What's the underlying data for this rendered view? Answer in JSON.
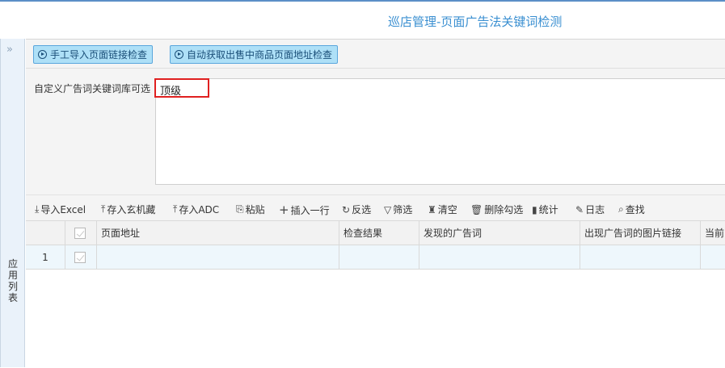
{
  "page": {
    "title": "巡店管理-页面广告法关键词检测"
  },
  "sidebar": {
    "collapse_glyph": "»",
    "label": "应用列表"
  },
  "toolbar": {
    "manual_import_label": "手工导入页面链接检查",
    "auto_fetch_label": "自动获取出售中商品页面地址检查"
  },
  "keywords": {
    "label": "自定义广告词关键词库可选",
    "value": "顶级"
  },
  "grid_toolbar": {
    "import_excel": "导入Excel",
    "save_xuanji": "存入玄机藏",
    "save_adc": "存入ADC",
    "paste": "粘贴",
    "insert_row": "插入一行",
    "invert": "反选",
    "filter": "筛选",
    "clear": "清空",
    "delete_checked": "删除勾选",
    "stats": "统计",
    "log": "日志",
    "find": "查找"
  },
  "table": {
    "columns": [
      "页面地址",
      "检查结果",
      "发现的广告词",
      "出现广告词的图片链接",
      "当前"
    ],
    "rows": [
      {
        "index": "1"
      }
    ]
  },
  "colors": {
    "accent": "#3a8fd1",
    "button_bg": "#aee0f7",
    "highlight_border": "#e02020",
    "row_bg": "#eef7fc"
  }
}
